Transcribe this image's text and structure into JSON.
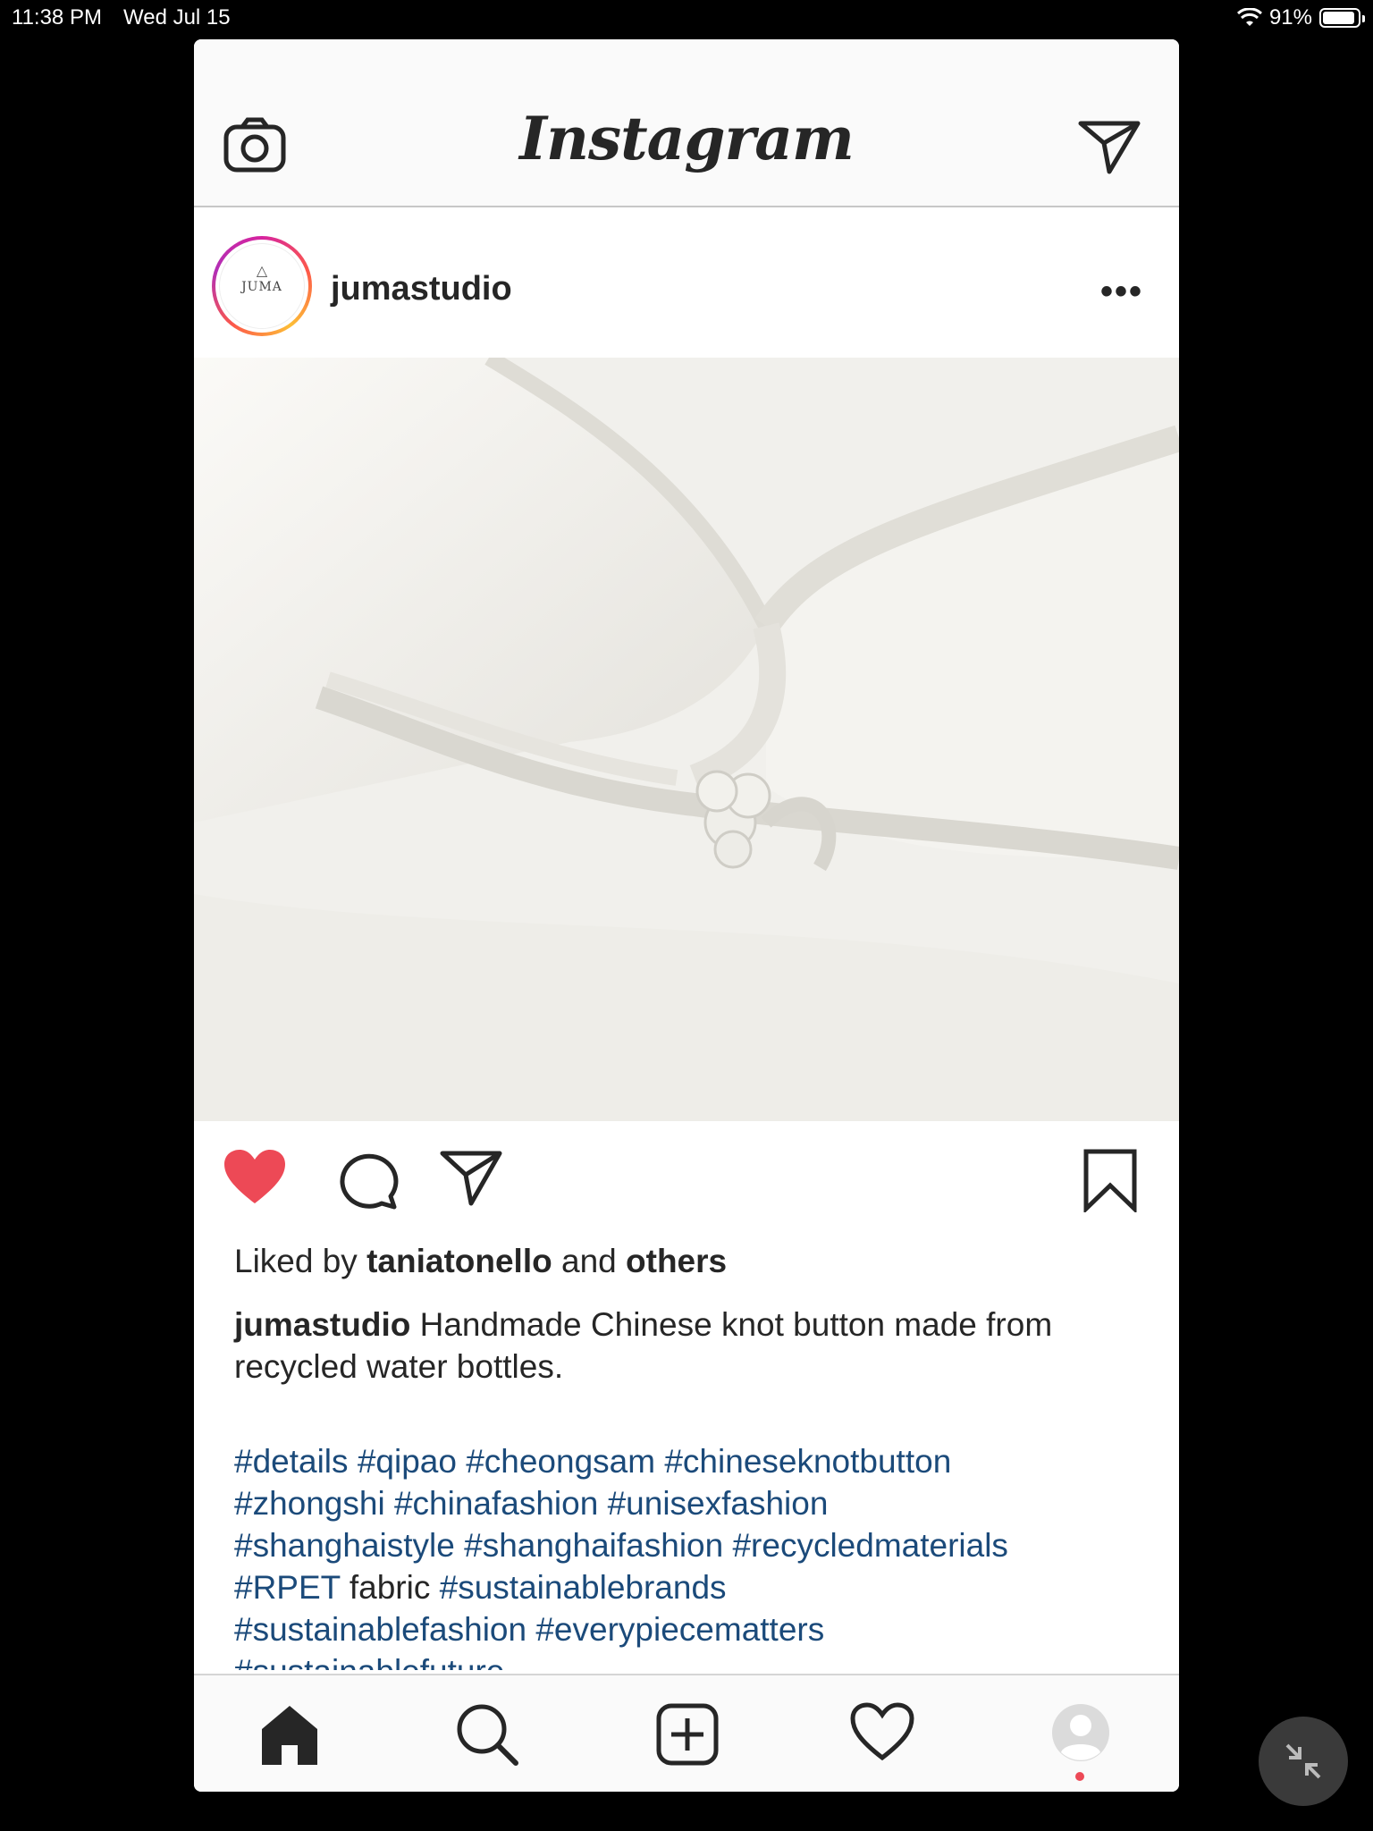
{
  "status_bar": {
    "time": "11:38 PM",
    "date": "Wed Jul 15",
    "battery": "91%",
    "battery_level": 0.91
  },
  "header": {
    "logo": "Instagram",
    "icons": [
      "camera-icon",
      "direct-message-icon"
    ]
  },
  "post": {
    "username": "jumastudio",
    "avatar_text": "JUMA",
    "likes": {
      "prefix": "Liked by ",
      "user": "taniatonello",
      "middle": " and ",
      "others": "others"
    },
    "caption": {
      "username": "jumastudio",
      "text": "Handmade Chinese knot button made from recycled water bottles."
    },
    "hashtags": {
      "line1": [
        "#details",
        "#qipao",
        "#cheongsam",
        "#chineseknotbutton"
      ],
      "line2": [
        "#zhongshi",
        "#chinafashion",
        "#unisexfashion"
      ],
      "line3": [
        "#shanghaistyle",
        "#shanghaifashion",
        "#recycledmaterials"
      ],
      "line4_tag1": "#RPET",
      "line4_word": "fabric",
      "line4_tag2": "#sustainablebrands",
      "line5": [
        "#sustainablefashion",
        "#everypiecematters"
      ],
      "line6_partial": "#sustainablefuture"
    },
    "liked": true,
    "like_color": "#ed4956"
  },
  "bottom_nav": {
    "items": [
      "home-icon",
      "search-icon",
      "new-post-icon",
      "activity-icon",
      "profile-icon"
    ],
    "notification_dot_color": "#ed4956"
  }
}
